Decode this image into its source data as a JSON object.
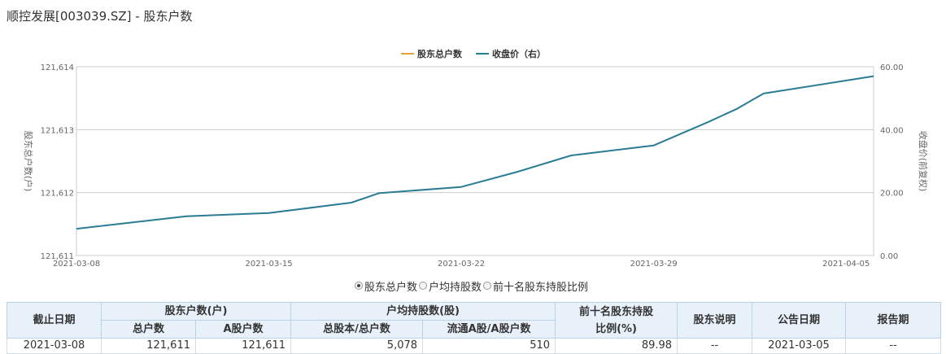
{
  "page": {
    "title": "顺控发展[003039.SZ] - 股东户数"
  },
  "chart_data": {
    "type": "line",
    "x": [
      "2021-03-08",
      "2021-03-12",
      "2021-03-15",
      "2021-03-18",
      "2021-03-19",
      "2021-03-22",
      "2021-03-24",
      "2021-03-26",
      "2021-03-29",
      "2021-03-31",
      "2021-04-01",
      "2021-04-02",
      "2021-04-06"
    ],
    "x_ticks": [
      "2021-03-08",
      "2021-03-15",
      "2021-03-22",
      "2021-03-29",
      "2021-04-05"
    ],
    "xlim": [
      "2021-03-08",
      "2021-04-06"
    ],
    "series": [
      {
        "name": "股东总户数",
        "axis": "left",
        "color": "#e8a33c",
        "values": []
      },
      {
        "name": "收盘价（右）",
        "axis": "right",
        "color": "#2a7c95",
        "values": [
          8.5,
          12.5,
          13.5,
          16.8,
          19.8,
          21.8,
          26.5,
          31.8,
          35.0,
          42.5,
          46.5,
          51.5,
          57.0
        ]
      }
    ],
    "y_left": {
      "label": "股东总户数(户)",
      "ticks": [
        "121,611",
        "121,612",
        "121,613",
        "121,614"
      ],
      "ylim": [
        121611,
        121614
      ]
    },
    "y_right": {
      "label": "收盘价(前复权)",
      "ticks": [
        "0.00",
        "20.00",
        "40.00",
        "60.00"
      ],
      "ylim": [
        0,
        60
      ]
    },
    "grid": true,
    "legend": "top-center"
  },
  "radio": {
    "options": [
      "股东总户数",
      "户均持股数",
      "前十名股东持股比例"
    ],
    "selected": 0
  },
  "table": {
    "headers": {
      "date": "截止日期",
      "holders_group": "股东户数(户)",
      "total_holders": "总户数",
      "a_holders": "A股户数",
      "avg_group": "户均持股数(股)",
      "avg_total": "总股本/总户数",
      "avg_float": "流通A股/A股户数",
      "top10_line1": "前十名股东持股",
      "top10_line2": "比例(%)",
      "note": "股东说明",
      "announce": "公告日期",
      "report": "报告期"
    },
    "rows": [
      [
        "2021-03-08",
        "121,611",
        "121,611",
        "5,078",
        "510",
        "89.98",
        "--",
        "2021-03-05",
        "--"
      ]
    ]
  },
  "colors": {
    "line": "#2a7c95",
    "holders": "#e8a33c",
    "grid": "#cccccc",
    "header_bg": "#e8f1fa"
  }
}
